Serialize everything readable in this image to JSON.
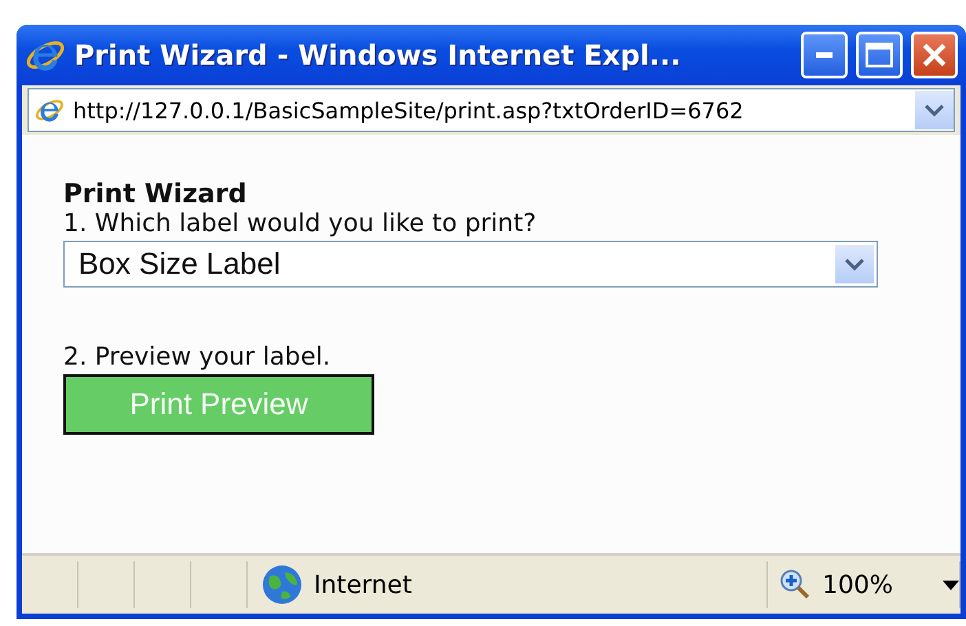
{
  "window": {
    "title": "Print Wizard - Windows Internet Expl..."
  },
  "address_bar": {
    "url": "http://127.0.0.1/BasicSampleSite/print.asp?txtOrderID=6762"
  },
  "page": {
    "heading": "Print Wizard",
    "step_1": "1. Which label would you like to print?",
    "label_select": {
      "value": "Box Size Label"
    },
    "step_2": "2. Preview your label.",
    "preview_button": "Print Preview"
  },
  "status_bar": {
    "zone": "Internet",
    "zoom": "100%"
  }
}
